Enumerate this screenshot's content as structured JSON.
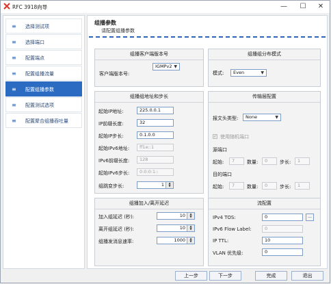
{
  "window": {
    "title": "RFC 3918向导",
    "minimize": "—",
    "maximize": "☐",
    "close": "✕"
  },
  "sidebar": {
    "items": [
      {
        "icon": "≡",
        "label": "选择测试项"
      },
      {
        "icon": "≡",
        "label": "选择端口"
      },
      {
        "icon": "≡",
        "label": "配置端点"
      },
      {
        "icon": "≡",
        "label": "配置组播流量"
      },
      {
        "icon": "≡",
        "label": "配置组播参数"
      },
      {
        "icon": "≡",
        "label": "配置测试选项"
      },
      {
        "icon": "≡",
        "label": "配置聚合组播吞吐量"
      }
    ]
  },
  "main": {
    "title": "组播参数",
    "subtitle": "请配置组播参数"
  },
  "version": {
    "title": "组播客户端版本号",
    "label": "客户端版本号:",
    "value": "IGMPv2"
  },
  "distribution": {
    "title": "组播组分布模式",
    "label": "模式:",
    "value": "Even"
  },
  "address": {
    "title": "组播组地址和步长",
    "start_ip_label": "起始IP地址:",
    "start_ip": "225.0.0.1",
    "prefix_label": "IP前缀长度:",
    "prefix": "32",
    "step_label": "起始IP步长:",
    "step": "0.1.0.0",
    "ipv6_start_label": "起始IPv6地址:",
    "ipv6_start": "ff1e::1",
    "ipv6_prefix_label": "IPv6前缀长度:",
    "ipv6_prefix": "128",
    "ipv6_step_label": "起始IPv6步长:",
    "ipv6_step": "0:0:0:1::",
    "group_step_label": "组跳变步长:",
    "group_step": "1"
  },
  "transport": {
    "title": "传输层配置",
    "header_label": "报文头类型:",
    "header_value": "None",
    "random_port_label": "使用随机端口",
    "src_label": "源端口",
    "dst_label": "目的端口",
    "start_label": "起始:",
    "count_label": "数量:",
    "step_label": "步长:",
    "src_start": "7",
    "src_count": "0",
    "src_step": "1",
    "dst_start": "7",
    "dst_count": "0",
    "dst_step": "1"
  },
  "join_leave": {
    "title": "组播加入/离开延迟",
    "join_label": "加入组延迟 (秒):",
    "join_value": "10",
    "leave_label": "离开组延迟 (秒):",
    "leave_value": "10",
    "rate_label": "组播发消息速率:",
    "rate_value": "1000"
  },
  "flow": {
    "title": "流配置",
    "tos_label": "IPv4 TOS:",
    "tos_value": "0",
    "tos_button": "...",
    "flow_label_label": "IPv6 Flow Label:",
    "flow_label_value": "0",
    "ttl_label": "IP TTL:",
    "ttl_value": "10",
    "vlan_label": "VLAN 优先级:",
    "vlan_value": "0"
  },
  "footer": {
    "prev": "上一步",
    "next": "下一步",
    "finish": "完成",
    "exit": "退出"
  },
  "colors": {
    "accent": "#2b6cc2",
    "dash": "#2b64b4",
    "app_icon": "#d93a2b"
  }
}
